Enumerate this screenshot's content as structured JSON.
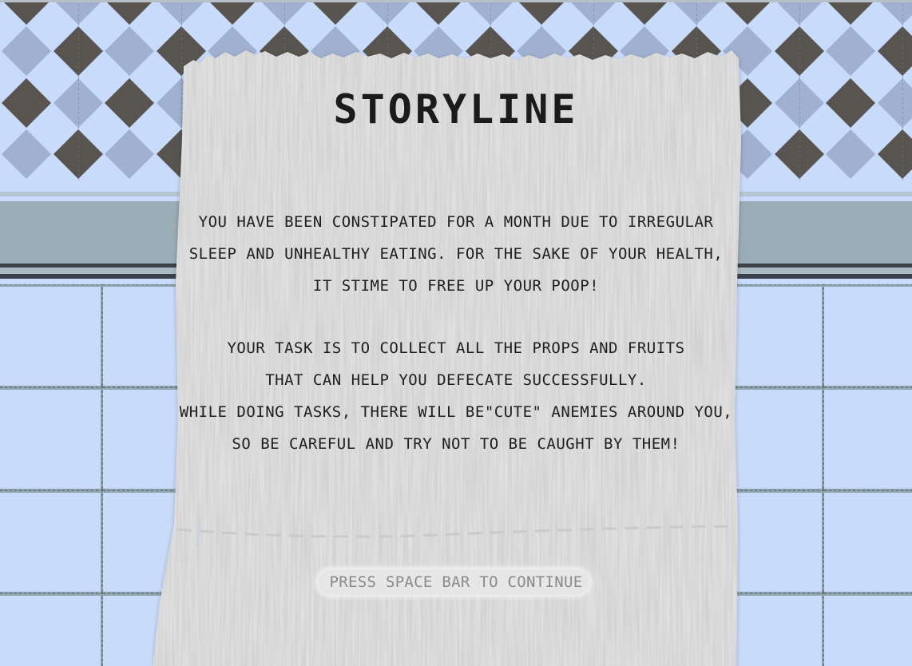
{
  "screen": {
    "title": "STORYLINE",
    "story_lines": [
      "YOU HAVE BEEN CONSTIPATED FOR A MONTH DUE TO IRREGULAR",
      "SLEEP AND UNHEALTHY EATING. FOR THE SAKE OF YOUR HEALTH,",
      "IT STIME TO FREE UP YOUR POOP!",
      "YOUR TASK IS TO COLLECT ALL THE PROPS AND FRUITS",
      "THAT CAN HELP YOU DEFECATE SUCCESSFULLY.",
      "WHILE DOING TASKS, THERE WILL BE\"CUTE\" ANEMIES AROUND YOU,",
      "SO BE CAREFUL AND TRY NOT TO BE CAUGHT BY THEM!"
    ],
    "continue_prompt": "PRESS SPACE BAR TO CONTINUE"
  },
  "colors": {
    "tile_light": "#c9dbfb",
    "tile_dark_diamond": "#585450",
    "tile_mid_diamond": "#9fb0d0",
    "wall_band": "#9aacb6",
    "grout": "#8fa3ad",
    "paper": "#e6e6e6",
    "text": "#1e1e1e",
    "prompt_text": "#8a8a8a"
  },
  "icons": [
    "toilet-paper-sheet"
  ]
}
